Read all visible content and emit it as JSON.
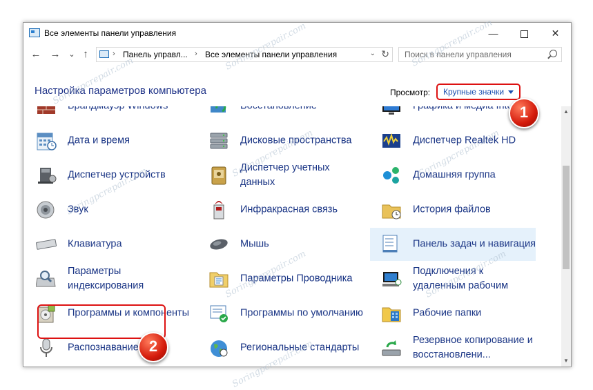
{
  "window": {
    "title": "Все элементы панели управления",
    "controls": {
      "minimize": "—",
      "maximize": "",
      "close": "✕"
    }
  },
  "nav": {
    "back": "←",
    "forward": "→",
    "recent": "⌄",
    "up": "↑",
    "path_sep": "›",
    "path": [
      "Панель управл...",
      "Все элементы панели управления"
    ],
    "dropdown": "⌄",
    "refresh": "↻",
    "search_placeholder": "Поиск в панели управления"
  },
  "heading": "Настройка параметров компьютера",
  "view_by": {
    "label": "Просмотр:",
    "value": "Крупные значки"
  },
  "items": [
    {
      "label": "Брандмауэр Windows",
      "icon": "firewall-icon"
    },
    {
      "label": "Восстановление",
      "icon": "recovery-icon"
    },
    {
      "label": "Графика и медиа Intel®",
      "icon": "intel-graphics-icon"
    },
    {
      "label": "Дата и время",
      "icon": "date-time-icon"
    },
    {
      "label": "Дисковые пространства",
      "icon": "storage-spaces-icon"
    },
    {
      "label": "Диспетчер Realtek HD",
      "icon": "realtek-icon"
    },
    {
      "label": "Диспетчер устройств",
      "icon": "device-manager-icon"
    },
    {
      "label": "Диспетчер учетных данных",
      "icon": "credential-manager-icon"
    },
    {
      "label": "Домашняя группа",
      "icon": "homegroup-icon"
    },
    {
      "label": "Звук",
      "icon": "sound-icon"
    },
    {
      "label": "Инфракрасная связь",
      "icon": "infrared-icon"
    },
    {
      "label": "История файлов",
      "icon": "file-history-icon"
    },
    {
      "label": "Клавиатура",
      "icon": "keyboard-icon"
    },
    {
      "label": "Мышь",
      "icon": "mouse-icon"
    },
    {
      "label": "Панель задач и навигация",
      "icon": "taskbar-icon"
    },
    {
      "label": "Параметры индексирования",
      "icon": "indexing-icon"
    },
    {
      "label": "Параметры Проводника",
      "icon": "explorer-options-icon"
    },
    {
      "label": "Подключения к удаленным рабочим",
      "icon": "remote-desktop-icon"
    },
    {
      "label": "Программы и компоненты",
      "icon": "programs-features-icon"
    },
    {
      "label": "Программы по умолчанию",
      "icon": "default-programs-icon"
    },
    {
      "label": "Рабочие папки",
      "icon": "work-folders-icon"
    },
    {
      "label": "Распознавание речи",
      "icon": "speech-recognition-icon"
    },
    {
      "label": "Региональные стандарты",
      "icon": "region-icon"
    },
    {
      "label": "Резервное копирование и восстановлени...",
      "icon": "backup-restore-icon"
    }
  ],
  "scrollbar": {
    "up": "▲",
    "down": "▼"
  },
  "badges": {
    "one": "1",
    "two": "2"
  },
  "watermark": "Soringpcrepair.com",
  "colors": {
    "link": "#1a3585",
    "highlight": "#dd1111",
    "heading": "#1e3287"
  }
}
